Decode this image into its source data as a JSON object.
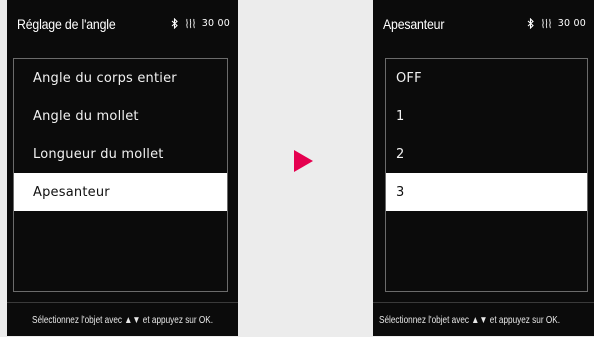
{
  "left_screen": {
    "title": "Réglage de l'angle",
    "status": {
      "time": "30 00"
    },
    "menu": [
      {
        "label": "Angle du corps entier"
      },
      {
        "label": "Angle du mollet"
      },
      {
        "label": "Longueur du mollet"
      },
      {
        "label": "Apesanteur",
        "selected": true
      }
    ],
    "hint": "Sélectionnez l'objet avec ▲▼ et appuyez sur OK."
  },
  "right_screen": {
    "title": "Apesanteur",
    "status": {
      "time": "30 00"
    },
    "menu": [
      {
        "label": "OFF"
      },
      {
        "label": "1"
      },
      {
        "label": "2"
      },
      {
        "label": "3",
        "selected": true
      }
    ],
    "hint": "Sélectionnez l'objet avec ▲▼ et appuyez sur OK."
  },
  "transition": {
    "icon": "arrow-right-icon",
    "color": "#e5004f"
  },
  "colors": {
    "screen_bg": "#0b0b0b",
    "page_bg": "#ececec",
    "selected_bg": "#ffffff"
  }
}
